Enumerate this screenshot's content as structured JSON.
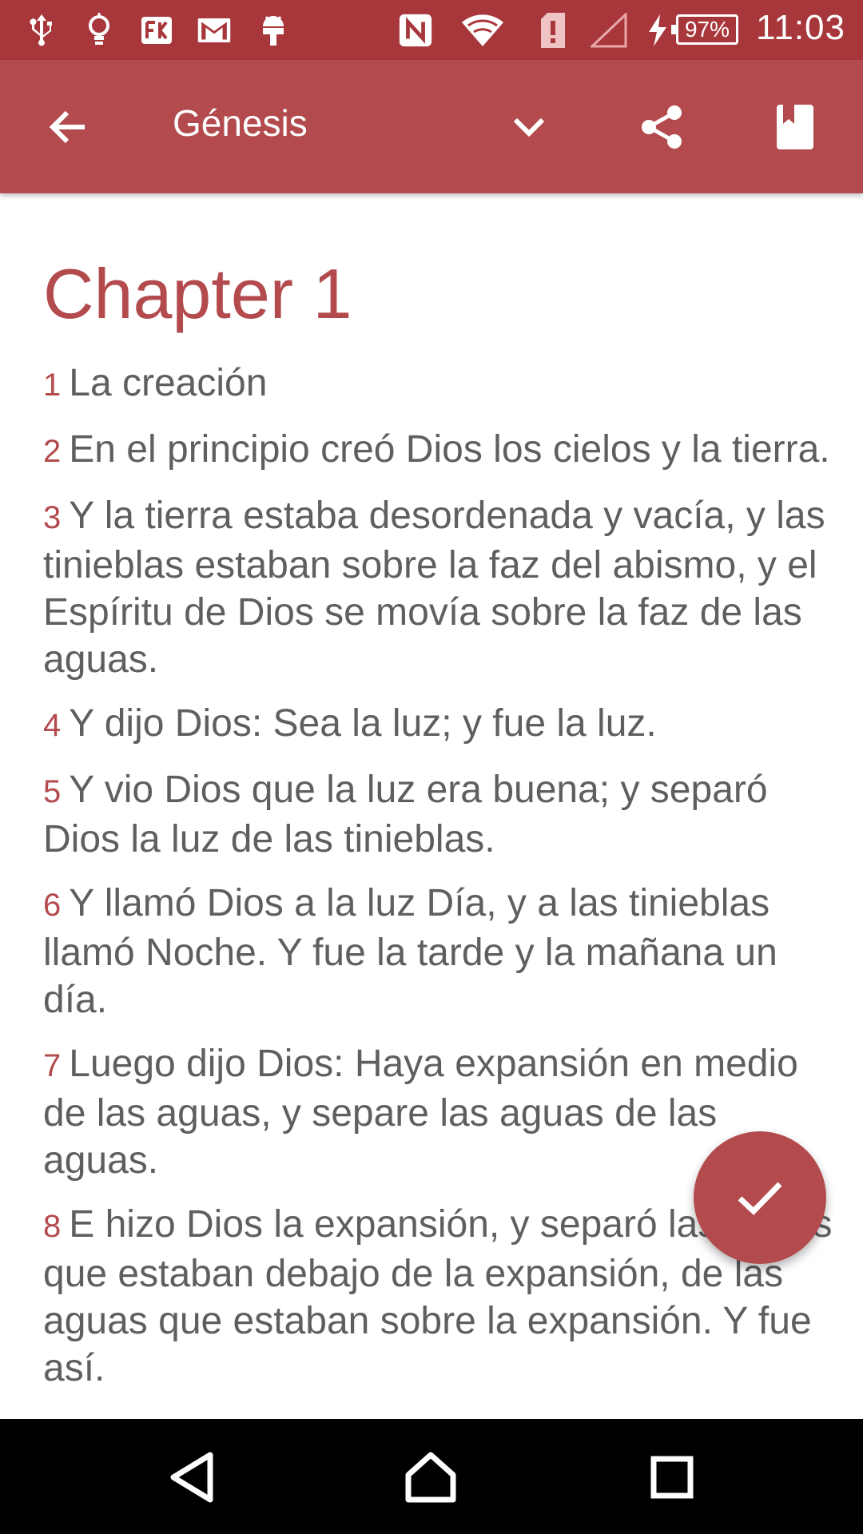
{
  "status_bar": {
    "time": "11:03",
    "battery": "97%",
    "icons": [
      "usb-icon",
      "lightbulb-icon",
      "store-icon",
      "gmail-icon",
      "android-icon",
      "nfc-icon",
      "wifi-icon",
      "sim-alert-icon",
      "signal-icon",
      "charging-icon"
    ]
  },
  "app_bar": {
    "title": "Génesis",
    "background": "#b34b4e",
    "icons": [
      "arrow-back-icon",
      "chevron-down-icon",
      "share-icon",
      "bookmark-icon"
    ]
  },
  "chapter": {
    "title": "Chapter 1",
    "verses": [
      {
        "num": "1",
        "text": "La creación"
      },
      {
        "num": "2",
        "text": "En el principio creó Dios los cielos y la tierra."
      },
      {
        "num": "3",
        "text": "Y la tierra estaba desordenada y vacía, y las tinieblas estaban sobre la faz del abismo, y el Espíritu de Dios se movía sobre la faz de las aguas."
      },
      {
        "num": "4",
        "text": "Y dijo Dios: Sea la luz; y fue la luz."
      },
      {
        "num": "5",
        "text": "Y vio Dios que la luz era buena; y separó Dios la luz de las tinieblas."
      },
      {
        "num": "6",
        "text": "Y llamó Dios a la luz Día, y a las tinieblas llamó Noche. Y fue la tarde y la mañana un día."
      },
      {
        "num": "7",
        "text": "Luego dijo Dios: Haya expansión en medio de las aguas, y separe las aguas de las aguas."
      },
      {
        "num": "8",
        "text": "E hizo Dios la expansión, y separó las aguas que estaban debajo de la expansión, de las aguas que estaban sobre la expansión. Y fue así."
      }
    ]
  },
  "fab": {
    "icon": "check-icon",
    "color": "#b34b4e"
  },
  "nav_bar": {
    "icons": [
      "nav-back-icon",
      "nav-home-icon",
      "nav-recents-icon"
    ]
  }
}
